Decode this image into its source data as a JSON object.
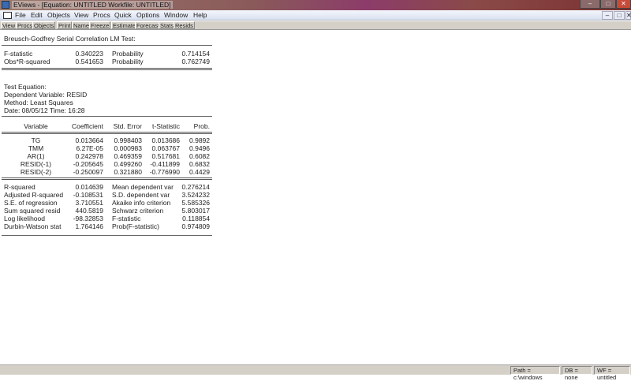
{
  "window": {
    "title": "EViews - [Equation: UNTITLED   Workfile: UNTITLED]",
    "min": "‒",
    "max": "□",
    "close": "✕"
  },
  "menu": [
    "File",
    "Edit",
    "Objects",
    "View",
    "Procs",
    "Quick",
    "Options",
    "Window",
    "Help"
  ],
  "toolbar": [
    "View",
    "Procs",
    "Objects",
    "Print",
    "Name",
    "Freeze",
    "Estimate",
    "Forecast",
    "Stats",
    "Resids"
  ],
  "test": {
    "title": "Breusch-Godfrey Serial Correlation LM Test:",
    "rows": [
      {
        "label": "F-statistic",
        "value": "0.340223",
        "plabel": "Probability",
        "pvalue": "0.714154"
      },
      {
        "label": "Obs*R-squared",
        "value": "0.541653",
        "plabel": "Probability",
        "pvalue": "0.762749"
      }
    ]
  },
  "equation": {
    "line1": "Test Equation:",
    "line2": "Dependent Variable: RESID",
    "line3": "Method: Least Squares",
    "date": "Date: 08/05/12   Time: 16:28"
  },
  "coef": {
    "headers": [
      "Variable",
      "Coefficient",
      "Std. Error",
      "t-Statistic",
      "Prob."
    ],
    "rows": [
      [
        "TG",
        "0.013664",
        "0.998403",
        "0.013686",
        "0.9892"
      ],
      [
        "TMM",
        "6.27E-05",
        "0.000983",
        "0.063767",
        "0.9496"
      ],
      [
        "AR(1)",
        "0.242978",
        "0.469359",
        "0.517681",
        "0.6082"
      ],
      [
        "RESID(-1)",
        "-0.205645",
        "0.499260",
        "-0.411899",
        "0.6832"
      ],
      [
        "RESID(-2)",
        "-0.250097",
        "0.321880",
        "-0.776990",
        "0.4429"
      ]
    ]
  },
  "stats": [
    [
      "R-squared",
      "0.014639",
      "Mean dependent var",
      "0.276214"
    ],
    [
      "Adjusted R-squared",
      "-0.108531",
      "S.D. dependent var",
      "3.524232"
    ],
    [
      "S.E. of regression",
      "3.710551",
      "Akaike info criterion",
      "5.585326"
    ],
    [
      "Sum squared resid",
      "440.5819",
      "Schwarz criterion",
      "5.803017"
    ],
    [
      "Log likelihood",
      "-98.32853",
      "F-statistic",
      "0.118854"
    ],
    [
      "Durbin-Watson stat",
      "1.764146",
      "Prob(F-statistic)",
      "0.974809"
    ]
  ],
  "status": {
    "path": "Path = c:\\windows",
    "db": "DB = none",
    "wf": "WF = untitled"
  }
}
